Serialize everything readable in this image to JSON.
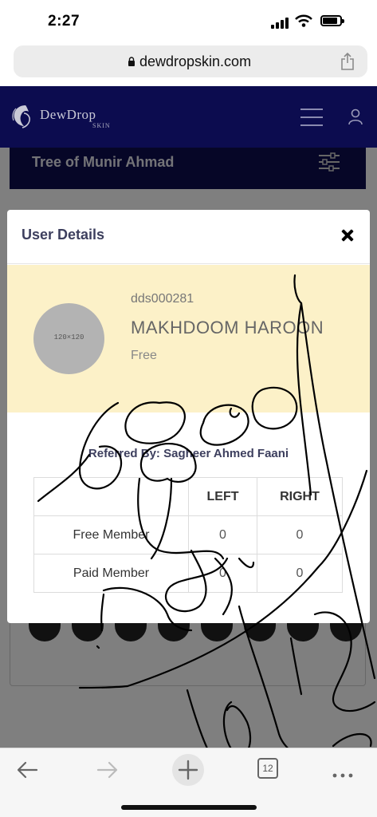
{
  "status_bar": {
    "time": "2:27"
  },
  "browser": {
    "url": "dewdropskin.com",
    "tab_count": "12"
  },
  "site": {
    "logo_text": "DewDrop",
    "logo_sub": "SKIN",
    "page_title": "Tree of Munir Ahmad"
  },
  "modal": {
    "title": "User Details",
    "user_id": "dds000281",
    "user_name": "MAKHDOOM HAROON",
    "plan": "Free",
    "avatar_placeholder": "120×120",
    "referred_label": "Referred By:",
    "referred_name": "Sagheer Ahmed Faani",
    "table": {
      "headers": [
        "",
        "LEFT",
        "RIGHT"
      ],
      "rows": [
        {
          "label": "Free Member",
          "left": "0",
          "right": "0"
        },
        {
          "label": "Paid Member",
          "left": "0",
          "right": "0"
        }
      ]
    }
  },
  "colors": {
    "header_navy": "#0c0c4f",
    "profile_band": "#fcf1c8",
    "title_text": "#3d3f5e"
  }
}
